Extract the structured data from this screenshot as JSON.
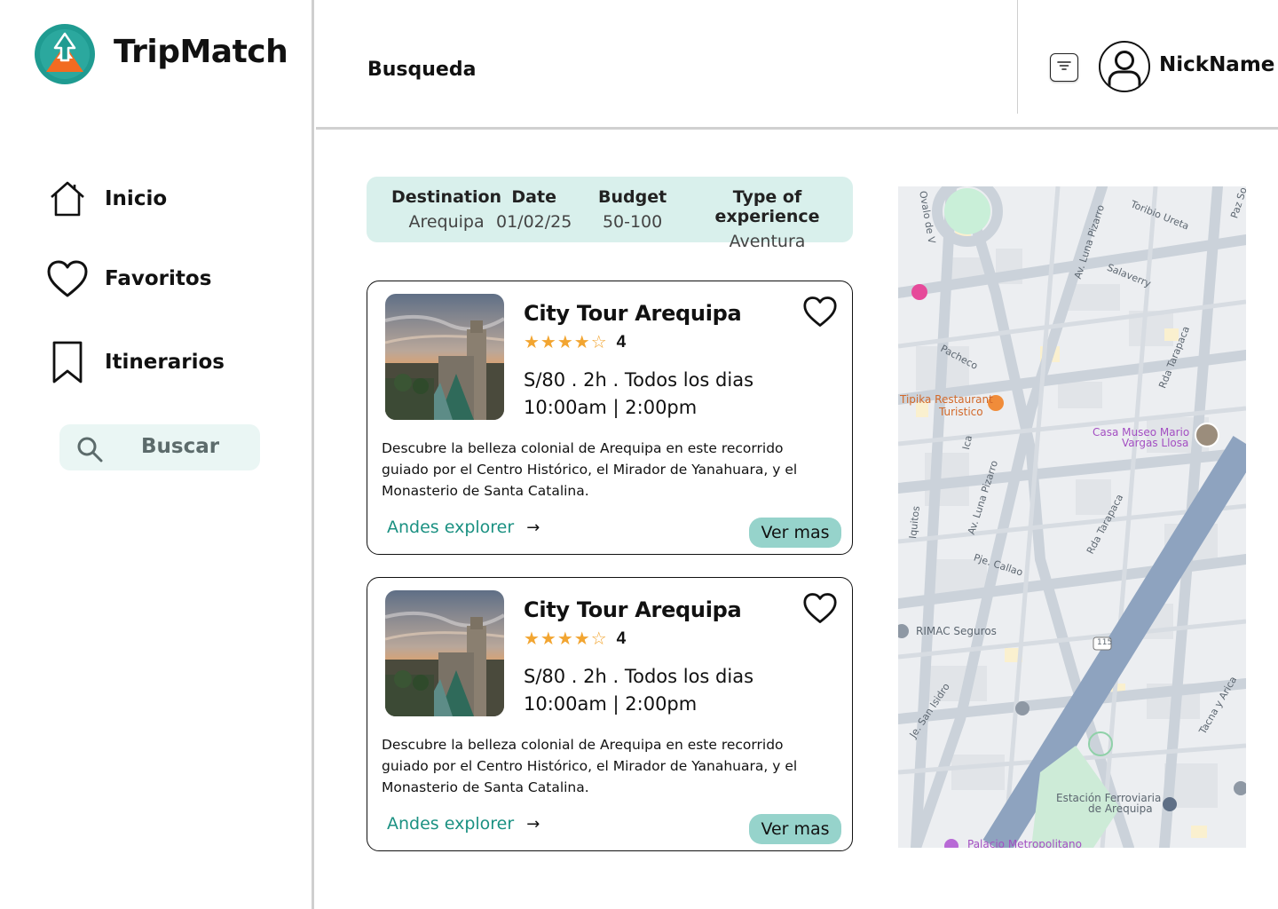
{
  "app": {
    "name": "TripMatch"
  },
  "sidebar": {
    "items": [
      {
        "label": "Inicio",
        "icon": "home-icon"
      },
      {
        "label": "Favoritos",
        "icon": "heart-icon"
      },
      {
        "label": "Itinerarios",
        "icon": "bookmark-icon"
      }
    ],
    "search": {
      "label": "Buscar",
      "icon": "search-icon"
    }
  },
  "header": {
    "title": "Busqueda",
    "filter_icon": "filter-icon",
    "user": {
      "name": "NickName",
      "icon": "user-icon"
    }
  },
  "filters": {
    "columns": [
      {
        "header": "Destination",
        "value": "Arequipa"
      },
      {
        "header": "Date",
        "value": "01/02/25"
      },
      {
        "header": "Budget",
        "value": "50-100"
      },
      {
        "header": "Type of experience",
        "value": "Aventura"
      }
    ]
  },
  "results": [
    {
      "title": "City Tour Arequipa",
      "stars": "★★★★☆",
      "rating": "4",
      "price_line": "S/80 . 2h . Todos los dias",
      "time_line": "10:00am | 2:00pm",
      "description": "Descubre la belleza colonial de Arequipa en este recorrido guiado por el Centro Histórico, el Mirador de Yanahuara, y el Monasterio de Santa Catalina.",
      "provider": "Andes explorer",
      "arrow": "→",
      "more_label": "Ver mas"
    },
    {
      "title": "City Tour Arequipa",
      "stars": "★★★★☆",
      "rating": "4",
      "price_line": "S/80 . 2h . Todos los dias",
      "time_line": "10:00am | 2:00pm",
      "description": "Descubre la belleza colonial de Arequipa en este recorrido guiado por el Centro Histórico, el Mirador de Yanahuara, y el Monasterio de Santa Catalina.",
      "provider": "Andes explorer",
      "arrow": "→",
      "more_label": "Ver mas"
    }
  ],
  "map": {
    "labels": [
      "Ovalo de V",
      "Toribio Ureta",
      "Av. Luna Pizarro",
      "Salaverry",
      "Paz So",
      "Pacheco",
      "Rda Tarapaca",
      "Tipika Restaurant",
      "Turistico",
      "Casa Museo Mario",
      "Vargas Llosa",
      "Ica",
      "Av. Luna Pizarro",
      "Iquitos",
      "Rda Tarapaca",
      "Pje. Callao",
      "RIMAC Seguros",
      "115",
      "Je. San Isidro",
      "Tacna y Arica",
      "Estación Ferroviaria",
      "de Arequipa",
      "Palacio Metropolitano"
    ]
  },
  "colors": {
    "accent": "#1b9182",
    "button_bg": "#96d3cb",
    "summary_bg": "#d9f0ec",
    "search_bg": "#eaf6f4",
    "star": "#f2a531"
  }
}
